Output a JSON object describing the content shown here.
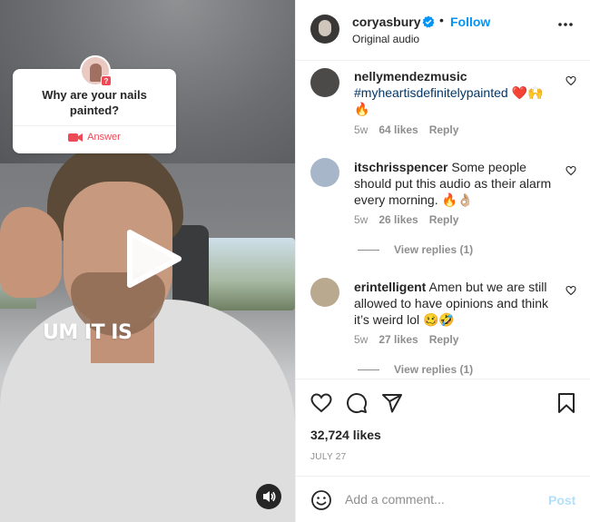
{
  "video": {
    "question_text": "Why are your nails painted?",
    "answer_label": "Answer",
    "caption_overlay": "UM IT IS",
    "question_badge": "?",
    "icons": {
      "play": "play-icon",
      "audio": "speaker-icon",
      "camera": "video-camera-icon"
    }
  },
  "header": {
    "username": "coryasbury",
    "separator": "•",
    "follow_label": "Follow",
    "subtitle": "Original audio",
    "icons": {
      "verified": "verified-badge-icon",
      "more": "more-options-icon"
    },
    "colors": {
      "follow": "#0095f6",
      "verified": "#0095f6"
    }
  },
  "comments": [
    {
      "user": "nellymendezmusic",
      "text": "#myheartisdefinitelypainted ❤️🙌 🔥",
      "time": "5w",
      "likes": "64 likes",
      "reply": "Reply"
    },
    {
      "user": "itschrisspencer",
      "text": "Some people should put this audio as their alarm every morning. 🔥👌🏼",
      "time": "5w",
      "likes": "26 likes",
      "reply": "Reply",
      "view_replies": "View replies (1)"
    },
    {
      "user": "erintelligent",
      "text": "Amen but we are still allowed to have opinions and think it’s weird lol 🥴🤣",
      "time": "5w",
      "likes": "27 likes",
      "reply": "Reply",
      "view_replies": "View replies (1)"
    }
  ],
  "actions": {
    "likes_count": "32,724 likes",
    "date": "JULY 27",
    "icons": [
      "heart-icon",
      "comment-icon",
      "share-icon",
      "bookmark-icon"
    ]
  },
  "comment_bar": {
    "placeholder": "Add a comment...",
    "post_label": "Post",
    "icons": {
      "emoji": "emoji-icon"
    },
    "colors": {
      "post_disabled": "#b2dffc"
    }
  }
}
